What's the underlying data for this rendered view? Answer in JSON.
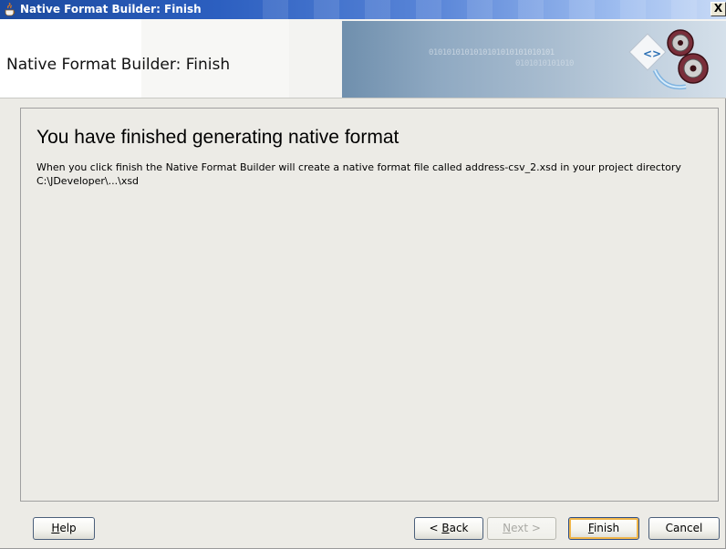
{
  "window": {
    "title": "Native Format Builder: Finish",
    "close_label": "X"
  },
  "header": {
    "title": "Native Format Builder: Finish",
    "banner_binary_1": "0101010101010101010101010101",
    "banner_binary_2": "0101010101010"
  },
  "main": {
    "heading": "You have finished generating native format",
    "description": "When you click finish the Native Format Builder will create a native format file called address-csv_2.xsd in your project directory C:\\JDeveloper\\...\\xsd"
  },
  "buttons": {
    "help": {
      "mnemonic": "H",
      "rest": "elp"
    },
    "back": {
      "prefix": "< ",
      "mnemonic": "B",
      "rest": "ack"
    },
    "next": {
      "mnemonic": "N",
      "rest": "ext >"
    },
    "finish": {
      "mnemonic": "F",
      "rest": "inish"
    },
    "cancel": {
      "label": "Cancel"
    }
  },
  "icons": {
    "app": "java-cup-icon",
    "close": "close-icon",
    "banner": "wizard-gear-graphic"
  },
  "colors": {
    "titlebar_start": "#1c4a9e",
    "titlebar_end": "#c8daf6",
    "dialog_bg": "#ecebe6",
    "default_button_highlight": "#f0b64a"
  }
}
